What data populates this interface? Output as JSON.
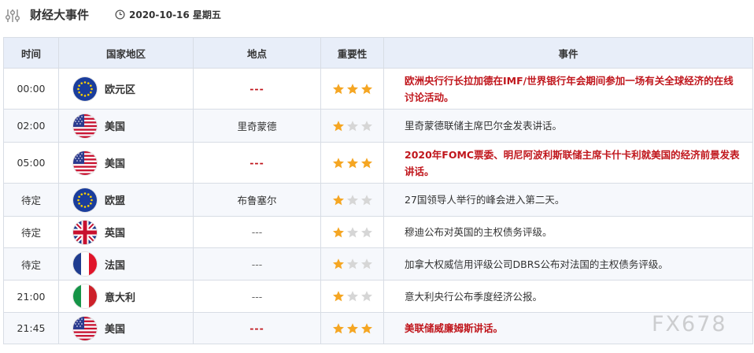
{
  "header": {
    "title": "财经大事件",
    "date": "2020-10-16 星期五"
  },
  "columns": [
    "时间",
    "国家地区",
    "地点",
    "重要性",
    "事件"
  ],
  "rows": [
    {
      "time": "00:00",
      "country": "欧元区",
      "flag": "eu",
      "location": "---",
      "importance": 3,
      "event": "欧洲央行行长拉加德在IMF/世界银行年会期间参加一场有关全球经济的在线讨论活动。"
    },
    {
      "time": "02:00",
      "country": "美国",
      "flag": "us",
      "location": "里奇蒙德",
      "importance": 1,
      "event": "里奇蒙德联储主席巴尔金发表讲话。"
    },
    {
      "time": "05:00",
      "country": "美国",
      "flag": "us",
      "location": "---",
      "importance": 3,
      "event": "2020年FOMC票委、明尼阿波利斯联储主席卡什卡利就美国的经济前景发表讲话。"
    },
    {
      "time": "待定",
      "country": "欧盟",
      "flag": "eu",
      "location": "布鲁塞尔",
      "importance": 1,
      "event": "27国领导人举行的峰会进入第二天。"
    },
    {
      "time": "待定",
      "country": "英国",
      "flag": "uk",
      "location": "---",
      "importance": 1,
      "event": "穆迪公布对英国的主权债务评级。"
    },
    {
      "time": "待定",
      "country": "法国",
      "flag": "fr",
      "location": "---",
      "importance": 1,
      "event": "加拿大权威信用评级公司DBRS公布对法国的主权债务评级。"
    },
    {
      "time": "21:00",
      "country": "意大利",
      "flag": "it",
      "location": "---",
      "importance": 1,
      "event": "意大利央行公布季度经济公报。"
    },
    {
      "time": "21:45",
      "country": "美国",
      "flag": "us",
      "location": "---",
      "importance": 3,
      "event": "美联储威廉姆斯讲话。"
    }
  ],
  "colors": {
    "star_on": "#f5a623",
    "star_off": "#d6d6d6",
    "highlight": "#c0161c",
    "header_bg": "#e8eef9"
  },
  "icons": {
    "header": "sliders-icon",
    "date": "clock-icon",
    "importance": "star-icon"
  },
  "watermark": "FX678"
}
